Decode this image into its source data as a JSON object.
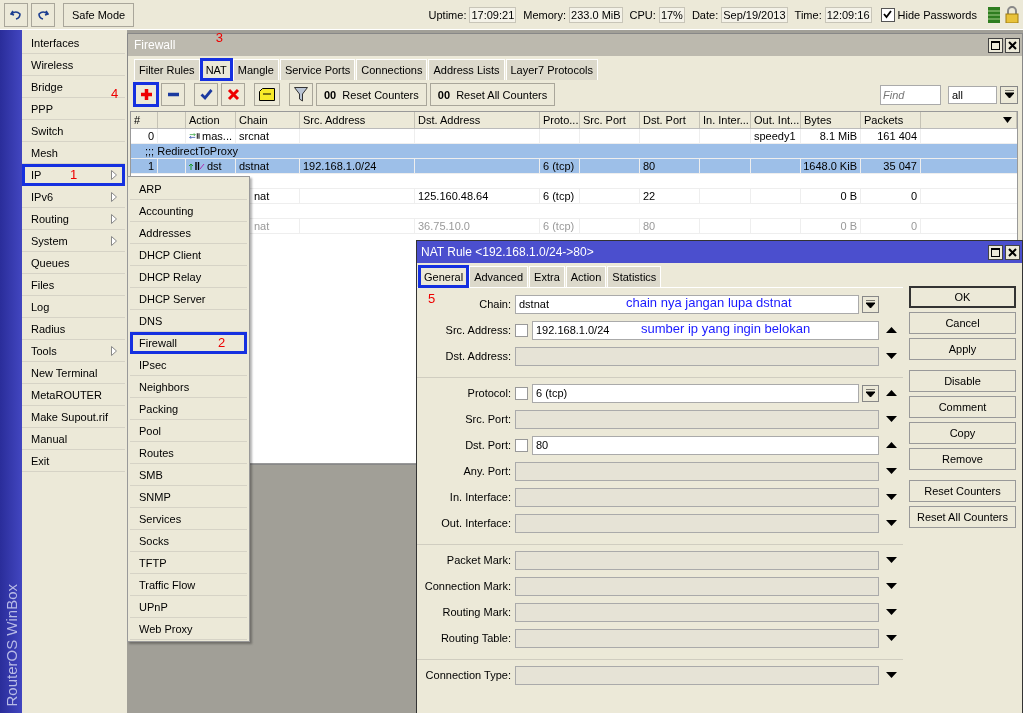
{
  "topbar": {
    "safe_mode": "Safe Mode",
    "status": [
      {
        "label": "Uptime:",
        "value": "17:09:21"
      },
      {
        "label": "Memory:",
        "value": "233.0 MiB"
      },
      {
        "label": "CPU:",
        "value": "17%"
      },
      {
        "label": "Date:",
        "value": "Sep/19/2013"
      },
      {
        "label": "Time:",
        "value": "12:09:16"
      }
    ],
    "hide_passwords": {
      "label": "Hide Passwords",
      "checked": true
    }
  },
  "side_title": "RouterOS WinBox",
  "sidebar": {
    "items": [
      {
        "label": "Interfaces",
        "submenu": false,
        "highlighted": false
      },
      {
        "label": "Wireless",
        "submenu": false,
        "highlighted": false
      },
      {
        "label": "Bridge",
        "submenu": false,
        "highlighted": false
      },
      {
        "label": "PPP",
        "submenu": false,
        "highlighted": false
      },
      {
        "label": "Switch",
        "submenu": false,
        "highlighted": false
      },
      {
        "label": "Mesh",
        "submenu": false,
        "highlighted": false
      },
      {
        "label": "IP",
        "submenu": true,
        "highlighted": true,
        "step": "1"
      },
      {
        "label": "IPv6",
        "submenu": true,
        "highlighted": false
      },
      {
        "label": "Routing",
        "submenu": true,
        "highlighted": false
      },
      {
        "label": "System",
        "submenu": true,
        "highlighted": false
      },
      {
        "label": "Queues",
        "submenu": false,
        "highlighted": false
      },
      {
        "label": "Files",
        "submenu": false,
        "highlighted": false
      },
      {
        "label": "Log",
        "submenu": false,
        "highlighted": false
      },
      {
        "label": "Radius",
        "submenu": false,
        "highlighted": false
      },
      {
        "label": "Tools",
        "submenu": true,
        "highlighted": false
      },
      {
        "label": "New Terminal",
        "submenu": false,
        "highlighted": false
      },
      {
        "label": "MetaROUTER",
        "submenu": false,
        "highlighted": false
      },
      {
        "label": "Make Supout.rif",
        "submenu": false,
        "highlighted": false
      },
      {
        "label": "Manual",
        "submenu": false,
        "highlighted": false
      },
      {
        "label": "Exit",
        "submenu": false,
        "highlighted": false
      }
    ]
  },
  "submenu": {
    "items": [
      {
        "label": "ARP",
        "highlighted": false
      },
      {
        "label": "Accounting",
        "highlighted": false
      },
      {
        "label": "Addresses",
        "highlighted": false
      },
      {
        "label": "DHCP Client",
        "highlighted": false
      },
      {
        "label": "DHCP Relay",
        "highlighted": false
      },
      {
        "label": "DHCP Server",
        "highlighted": false
      },
      {
        "label": "DNS",
        "highlighted": false
      },
      {
        "label": "Firewall",
        "highlighted": true,
        "step": "2"
      },
      {
        "label": "IPsec",
        "highlighted": false
      },
      {
        "label": "Neighbors",
        "highlighted": false
      },
      {
        "label": "Packing",
        "highlighted": false
      },
      {
        "label": "Pool",
        "highlighted": false
      },
      {
        "label": "Routes",
        "highlighted": false
      },
      {
        "label": "SMB",
        "highlighted": false
      },
      {
        "label": "SNMP",
        "highlighted": false
      },
      {
        "label": "Services",
        "highlighted": false
      },
      {
        "label": "Socks",
        "highlighted": false
      },
      {
        "label": "TFTP",
        "highlighted": false
      },
      {
        "label": "Traffic Flow",
        "highlighted": false
      },
      {
        "label": "UPnP",
        "highlighted": false
      },
      {
        "label": "Web Proxy",
        "highlighted": false
      }
    ]
  },
  "firewall": {
    "title": "Firewall",
    "tabs": [
      {
        "label": "Filter Rules",
        "selected": false,
        "highlighted": false
      },
      {
        "label": "NAT",
        "selected": true,
        "highlighted": true,
        "step": "3"
      },
      {
        "label": "Mangle",
        "selected": false,
        "highlighted": false
      },
      {
        "label": "Service Ports",
        "selected": false,
        "highlighted": false
      },
      {
        "label": "Connections",
        "selected": false,
        "highlighted": false
      },
      {
        "label": "Address Lists",
        "selected": false,
        "highlighted": false
      },
      {
        "label": "Layer7 Protocols",
        "selected": false,
        "highlighted": false
      }
    ],
    "tools": [
      {
        "kind": "add",
        "highlighted": true,
        "step": "4"
      },
      {
        "kind": "remove",
        "highlighted": false
      },
      {
        "kind": "enable",
        "highlighted": false
      },
      {
        "kind": "disable",
        "highlighted": false
      },
      {
        "kind": "comment",
        "highlighted": false
      },
      {
        "kind": "filter",
        "highlighted": false
      },
      {
        "kind": "reset",
        "highlighted": false,
        "prefix": "00",
        "label": "Reset Counters"
      },
      {
        "kind": "reset",
        "highlighted": false,
        "prefix": "00",
        "label": "Reset All Counters"
      }
    ],
    "find": {
      "placeholder": "Find"
    },
    "filter_select": {
      "value": "all"
    },
    "columns": [
      "#",
      null,
      "Action",
      "Chain",
      "Src. Address",
      "Dst. Address",
      "Proto...",
      "Src. Port",
      "Dst. Port",
      "In. Inter...",
      "Out. Int...",
      "Bytes",
      "Packets"
    ],
    "rows": [
      {
        "kind": "masquerade",
        "selected": false,
        "disabled": false,
        "cells": {
          "number": "0",
          "action": "mas...",
          "chain": "srcnat",
          "out_interface": "speedy1",
          "bytes": "8.1 MiB",
          "packets": "161 404"
        }
      },
      {
        "kind": "comment",
        "selected": true,
        "text": ";;; RedirectToProxy"
      },
      {
        "kind": "dstnat",
        "selected": true,
        "disabled": false,
        "cells": {
          "number": "1",
          "action": "dst",
          "chain": "dstnat",
          "src_address": "192.168.1.0/24",
          "protocol": "6 (tcp)",
          "dst_port": "80",
          "bytes": "1648.0 KiB",
          "packets": "35 047"
        }
      },
      {
        "kind": "comment",
        "selected": false
      },
      {
        "kind": "rule",
        "selected": false,
        "disabled": false,
        "cells": {
          "chain": "nat",
          "dst_address": "125.160.48.64",
          "protocol": "6 (tcp)",
          "dst_port": "22",
          "bytes": "0 B",
          "packets": "0"
        }
      },
      {
        "kind": "comment",
        "selected": false
      },
      {
        "kind": "rule",
        "selected": false,
        "disabled": true,
        "cells": {
          "chain": "nat",
          "dst_address": "36.75.10.0",
          "protocol": "6 (tcp)",
          "dst_port": "80",
          "bytes": "0 B",
          "packets": "0"
        }
      }
    ]
  },
  "nat_rule": {
    "title": "NAT Rule <192.168.1.0/24->80>",
    "tabs": [
      {
        "label": "General",
        "selected": true,
        "highlighted": true,
        "step": "5"
      },
      {
        "label": "Advanced",
        "selected": false,
        "highlighted": false
      },
      {
        "label": "Extra",
        "selected": false,
        "highlighted": false
      },
      {
        "label": "Action",
        "selected": false,
        "highlighted": false
      },
      {
        "label": "Statistics",
        "selected": false,
        "highlighted": false
      }
    ],
    "groups": [
      [
        {
          "label": "Chain:",
          "value": "dstnat",
          "has_negate": false,
          "dropdown": true,
          "note": "chain nya jangan lupa dstnat"
        },
        {
          "label": "Src. Address:",
          "value": "192.168.1.0/24",
          "has_negate": true,
          "negated": false,
          "dropdown": false,
          "expanded": true,
          "note": "sumber ip yang ingin belokan"
        },
        {
          "label": "Dst. Address:",
          "has_negate": false,
          "dropdown": false,
          "expanded": false
        }
      ],
      [
        {
          "label": "Protocol:",
          "value": "6 (tcp)",
          "has_negate": true,
          "negated": false,
          "dropdown": true,
          "expanded": true
        },
        {
          "label": "Src. Port:",
          "has_negate": false,
          "dropdown": false,
          "expanded": false
        },
        {
          "label": "Dst. Port:",
          "value": "80",
          "has_negate": true,
          "negated": false,
          "dropdown": false,
          "expanded": true
        },
        {
          "label": "Any. Port:",
          "has_negate": false,
          "dropdown": false,
          "expanded": false
        },
        {
          "label": "In. Interface:",
          "has_negate": false,
          "dropdown": false,
          "expanded": false
        },
        {
          "label": "Out. Interface:",
          "has_negate": false,
          "dropdown": false,
          "expanded": false
        }
      ],
      [
        {
          "label": "Packet Mark:",
          "has_negate": false,
          "dropdown": false,
          "expanded": false
        },
        {
          "label": "Connection Mark:",
          "has_negate": false,
          "dropdown": false,
          "expanded": false
        },
        {
          "label": "Routing Mark:",
          "has_negate": false,
          "dropdown": false,
          "expanded": false
        },
        {
          "label": "Routing Table:",
          "has_negate": false,
          "dropdown": false,
          "expanded": false
        }
      ],
      [
        {
          "label": "Connection Type:",
          "has_negate": false,
          "dropdown": false,
          "expanded": false
        }
      ]
    ],
    "buttons": [
      [
        {
          "label": "OK",
          "default": true
        },
        {
          "label": "Cancel",
          "default": false
        },
        {
          "label": "Apply",
          "default": false
        }
      ],
      [
        {
          "label": "Disable",
          "default": false
        },
        {
          "label": "Comment",
          "default": false
        },
        {
          "label": "Copy",
          "default": false
        },
        {
          "label": "Remove",
          "default": false
        }
      ],
      [
        {
          "label": "Reset Counters",
          "default": false
        },
        {
          "label": "Reset All Counters",
          "default": false
        }
      ]
    ]
  }
}
